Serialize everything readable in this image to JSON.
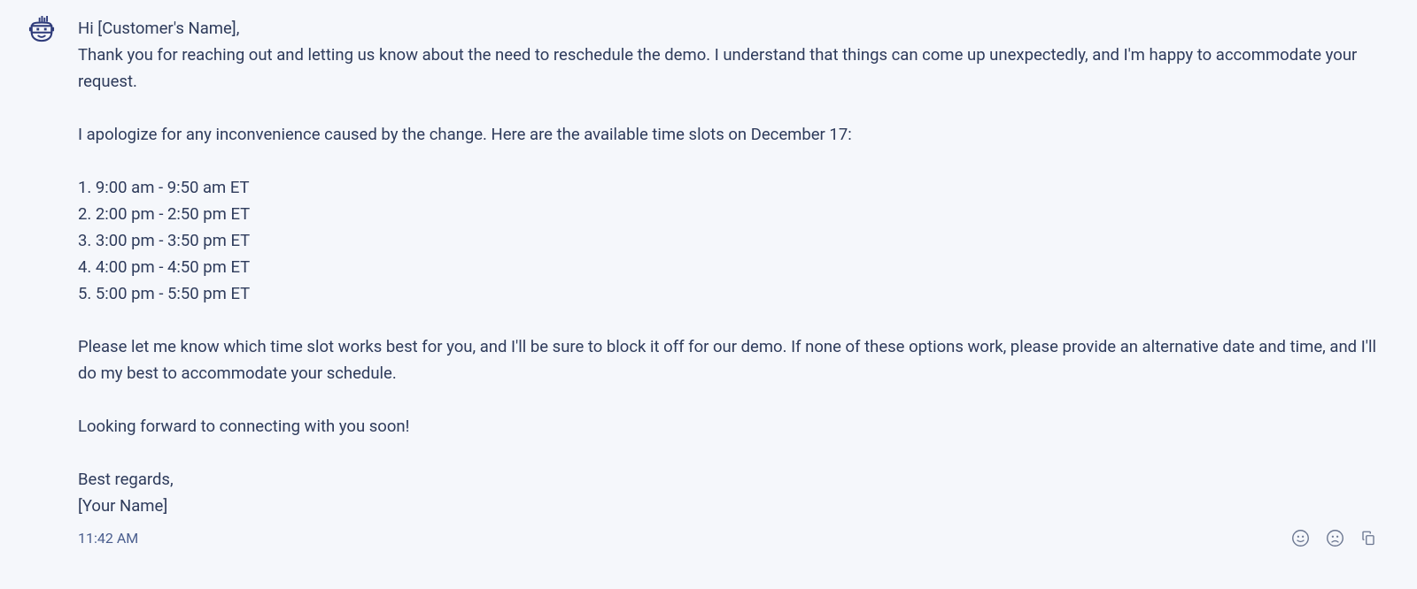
{
  "message": {
    "greeting": "Hi [Customer's Name],",
    "intro": "Thank you for reaching out and letting us know about the need to reschedule the demo. I understand that things can come up unexpectedly, and I'm happy to accommodate your request.",
    "apology": "I apologize for any inconvenience caused by the change. Here are the available time slots on December 17:",
    "slots": [
      "1. 9:00 am - 9:50 am ET",
      "2. 2:00 pm - 2:50 pm ET",
      "3. 3:00 pm - 3:50 pm ET",
      "4. 4:00 pm - 4:50 pm ET",
      "5. 5:00 pm - 5:50 pm ET"
    ],
    "instruction": "Please let me know which time slot works best for you, and I'll be sure to block it off for our demo. If none of these options work, please provide an alternative date and time, and I'll do my best to accommodate your schedule.",
    "closing": "Looking forward to connecting with you soon!",
    "signoff": "Best regards,",
    "signature": "[Your Name]"
  },
  "timestamp": "11:42 AM",
  "icons": {
    "smile": "smile-icon",
    "frown": "frown-icon",
    "copy": "copy-icon"
  },
  "avatar": {
    "name": "bot-avatar"
  }
}
